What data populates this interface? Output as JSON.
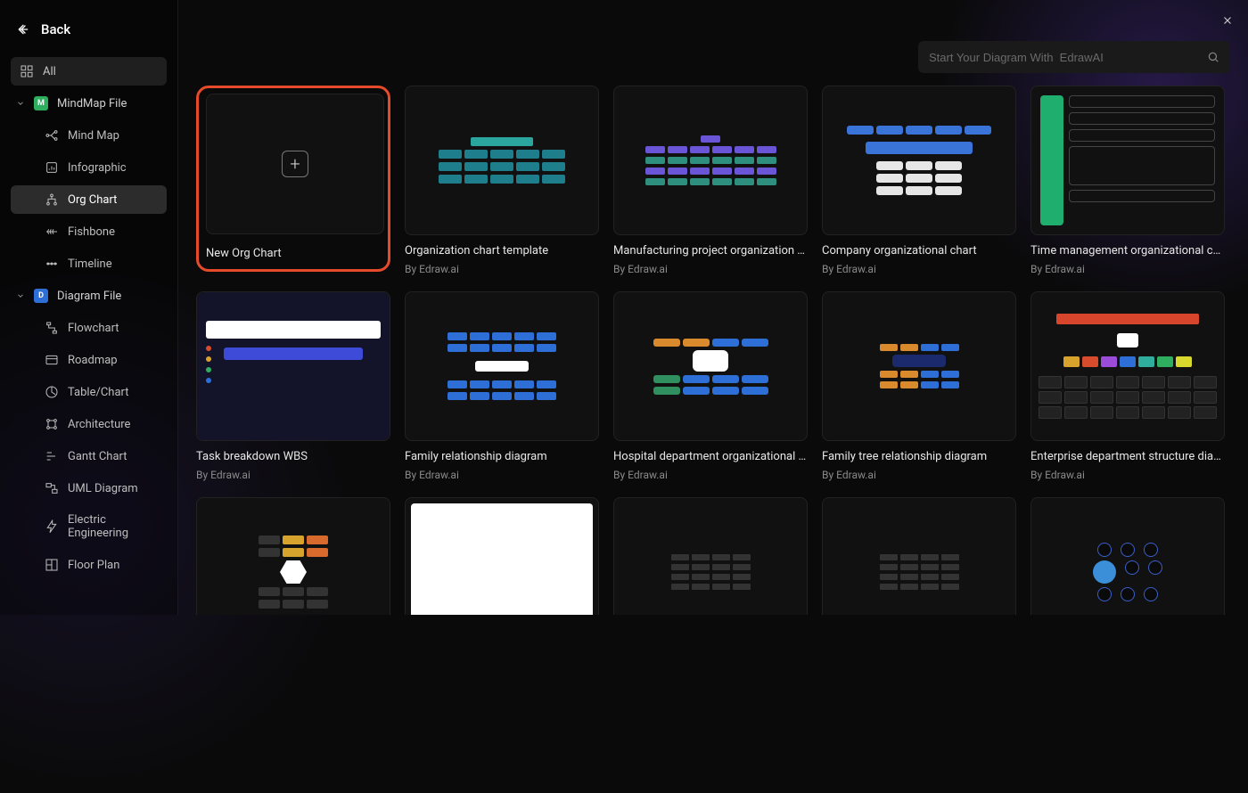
{
  "header": {
    "back_label": "Back",
    "search_placeholder": "Start Your Diagram With  EdrawAI"
  },
  "sidebar": {
    "all_label": "All",
    "groups": [
      {
        "label": "MindMap File",
        "tag": "M",
        "items": [
          {
            "label": "Mind Map"
          },
          {
            "label": "Infographic"
          },
          {
            "label": "Org Chart",
            "active": true
          },
          {
            "label": "Fishbone"
          },
          {
            "label": "Timeline"
          }
        ]
      },
      {
        "label": "Diagram File",
        "tag": "D",
        "items": [
          {
            "label": "Flowchart"
          },
          {
            "label": "Roadmap"
          },
          {
            "label": "Table/Chart"
          },
          {
            "label": "Architecture"
          },
          {
            "label": "Gantt Chart"
          },
          {
            "label": "UML Diagram"
          },
          {
            "label": "Electric Engineering"
          },
          {
            "label": "Floor Plan"
          }
        ]
      }
    ]
  },
  "templates": [
    {
      "title": "New Org Chart",
      "author": "",
      "new": true,
      "highlight": true
    },
    {
      "title": "Organization chart template",
      "author": "By Edraw.ai",
      "style": "orgA"
    },
    {
      "title": "Manufacturing project organization c...",
      "author": "By Edraw.ai",
      "style": "orgB"
    },
    {
      "title": "Company organizational chart",
      "author": "By Edraw.ai",
      "style": "orgC"
    },
    {
      "title": "Time management organizational chart",
      "author": "By Edraw.ai",
      "style": "timem"
    },
    {
      "title": "Task breakdown WBS",
      "author": "By Edraw.ai",
      "style": "wbs"
    },
    {
      "title": "Family relationship diagram",
      "author": "By Edraw.ai",
      "style": "fam"
    },
    {
      "title": "Hospital department organizational c...",
      "author": "By Edraw.ai",
      "style": "hosp"
    },
    {
      "title": "Family tree relationship diagram",
      "author": "By Edraw.ai",
      "style": "ftree"
    },
    {
      "title": "Enterprise department structure diag...",
      "author": "By Edraw.ai",
      "style": "ent"
    },
    {
      "title": "",
      "author": "",
      "style": "stage"
    },
    {
      "title": "",
      "author": "",
      "style": "plan"
    },
    {
      "title": "",
      "author": "",
      "style": "dark"
    },
    {
      "title": "",
      "author": "",
      "style": "dark"
    },
    {
      "title": "",
      "author": "",
      "style": "net"
    }
  ]
}
